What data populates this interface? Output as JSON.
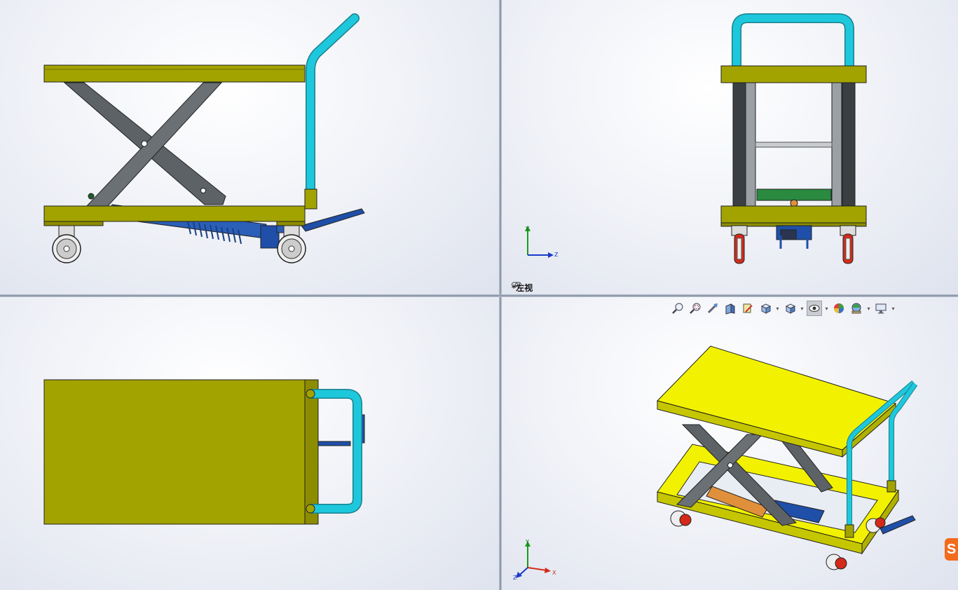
{
  "viewports": {
    "top_left": {
      "name": "front-view"
    },
    "top_right": {
      "name": "left-view",
      "label": "*左视"
    },
    "bottom_left": {
      "name": "top-view"
    },
    "bottom_right": {
      "name": "isometric-view"
    }
  },
  "triads": {
    "left_view": {
      "y": "Y",
      "z": "Z"
    },
    "iso_view": {
      "y": "Y",
      "x": "X",
      "z": "Z"
    }
  },
  "toolbar": {
    "items": [
      {
        "name": "zoom-to-fit-icon"
      },
      {
        "name": "zoom-to-area-icon"
      },
      {
        "name": "previous-view-icon"
      },
      {
        "name": "section-view-icon"
      },
      {
        "name": "dynamic-annotation-icon"
      },
      {
        "name": "view-orientation-icon",
        "dropdown": true
      },
      {
        "name": "display-style-icon",
        "dropdown": true
      },
      {
        "name": "hide-show-items-icon",
        "dropdown": true,
        "active": true
      },
      {
        "name": "edit-appearance-icon"
      },
      {
        "name": "apply-scene-icon",
        "dropdown": true
      },
      {
        "name": "view-settings-icon",
        "dropdown": true
      }
    ]
  },
  "colors": {
    "platform": "#a3a300",
    "platform_bright": "#f2f200",
    "handle": "#1ec8dc",
    "scissor": "#5c6266",
    "pump": "#1f4fa8",
    "wheel_red": "#d42a1a",
    "badge": "#f36b1c"
  },
  "badge": {
    "text": "S"
  }
}
